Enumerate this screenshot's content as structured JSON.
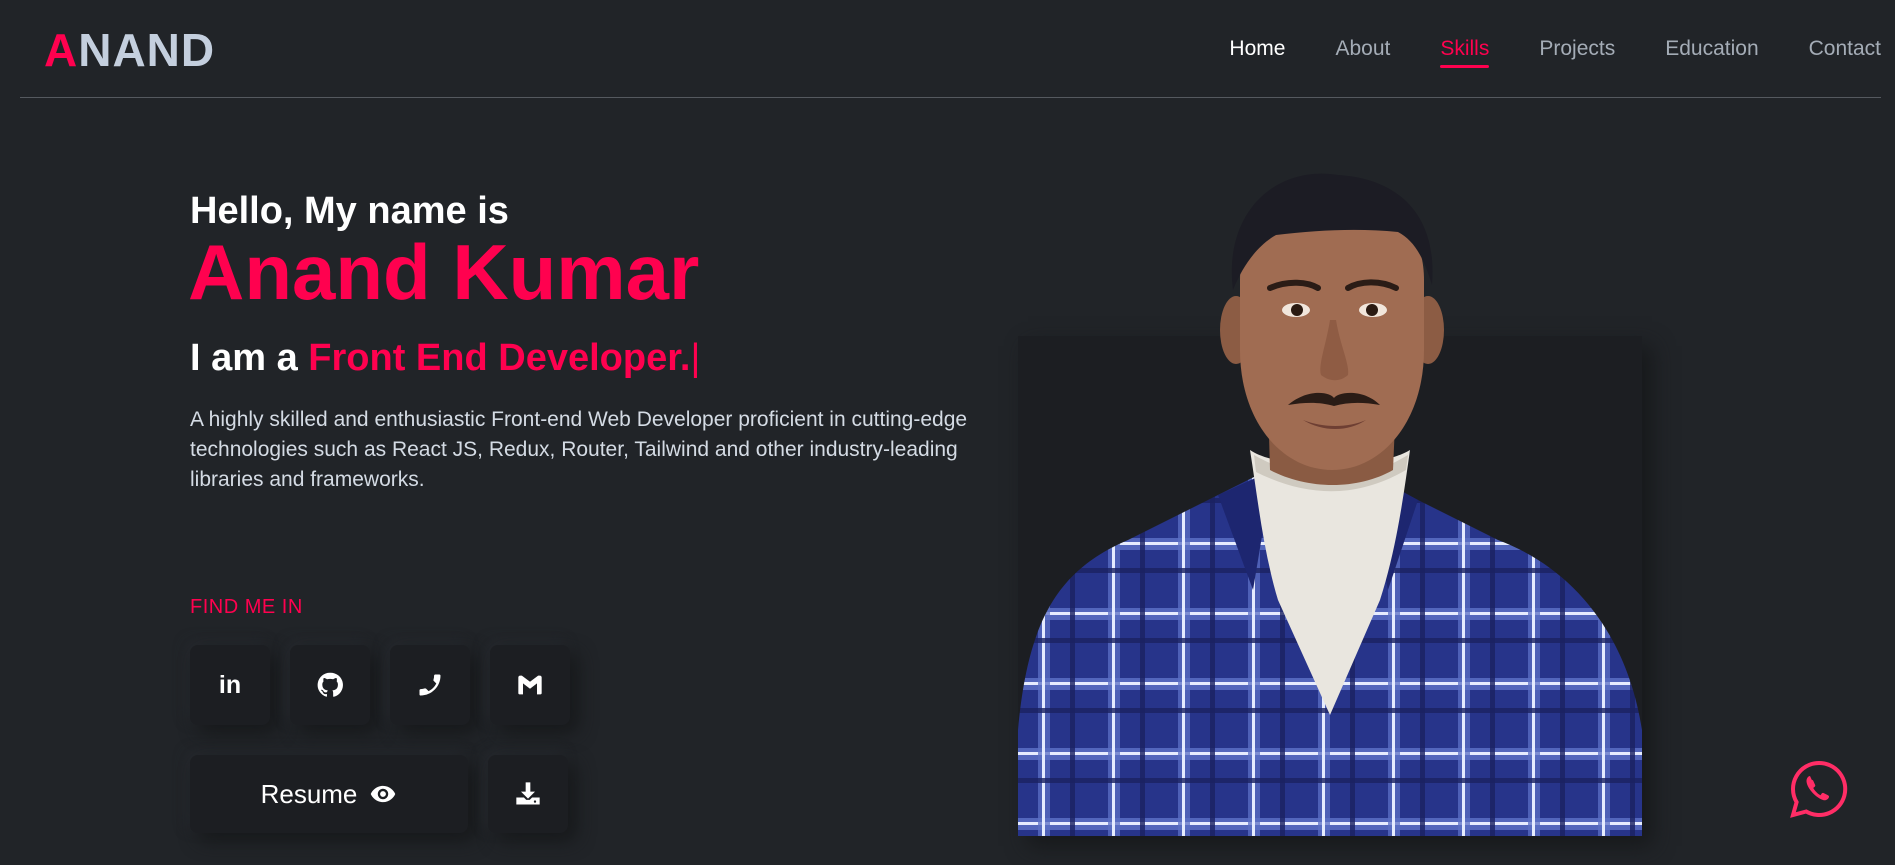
{
  "logo": {
    "first": "A",
    "rest": "NAND"
  },
  "nav": {
    "items": [
      {
        "label": "Home"
      },
      {
        "label": "About"
      },
      {
        "label": "Skills"
      },
      {
        "label": "Projects"
      },
      {
        "label": "Education"
      },
      {
        "label": "Contact"
      }
    ],
    "active": "Skills"
  },
  "hero": {
    "greeting": "Hello, My name is",
    "name": "Anand Kumar",
    "role_prefix": "I am a ",
    "role_highlight": "Front End Developer.",
    "cursor": "|",
    "description": "A highly skilled and enthusiastic Front-end Web Developer proficient in cutting-edge technologies such as React JS, Redux, Router, Tailwind and other industry-leading libraries and frameworks."
  },
  "find_me": {
    "title": "FIND ME IN",
    "socials": [
      {
        "icon": "linkedin-icon",
        "text": "in"
      },
      {
        "icon": "github-icon"
      },
      {
        "icon": "phone-icon"
      },
      {
        "icon": "gmail-icon"
      }
    ]
  },
  "resume": {
    "label": "Resume",
    "view_icon": "eye-icon",
    "download_icon": "download-icon"
  },
  "colors": {
    "accent": "#ff014f",
    "background": "#212428",
    "card": "#1c1e22"
  },
  "floating": {
    "icon": "whatsapp-icon"
  }
}
